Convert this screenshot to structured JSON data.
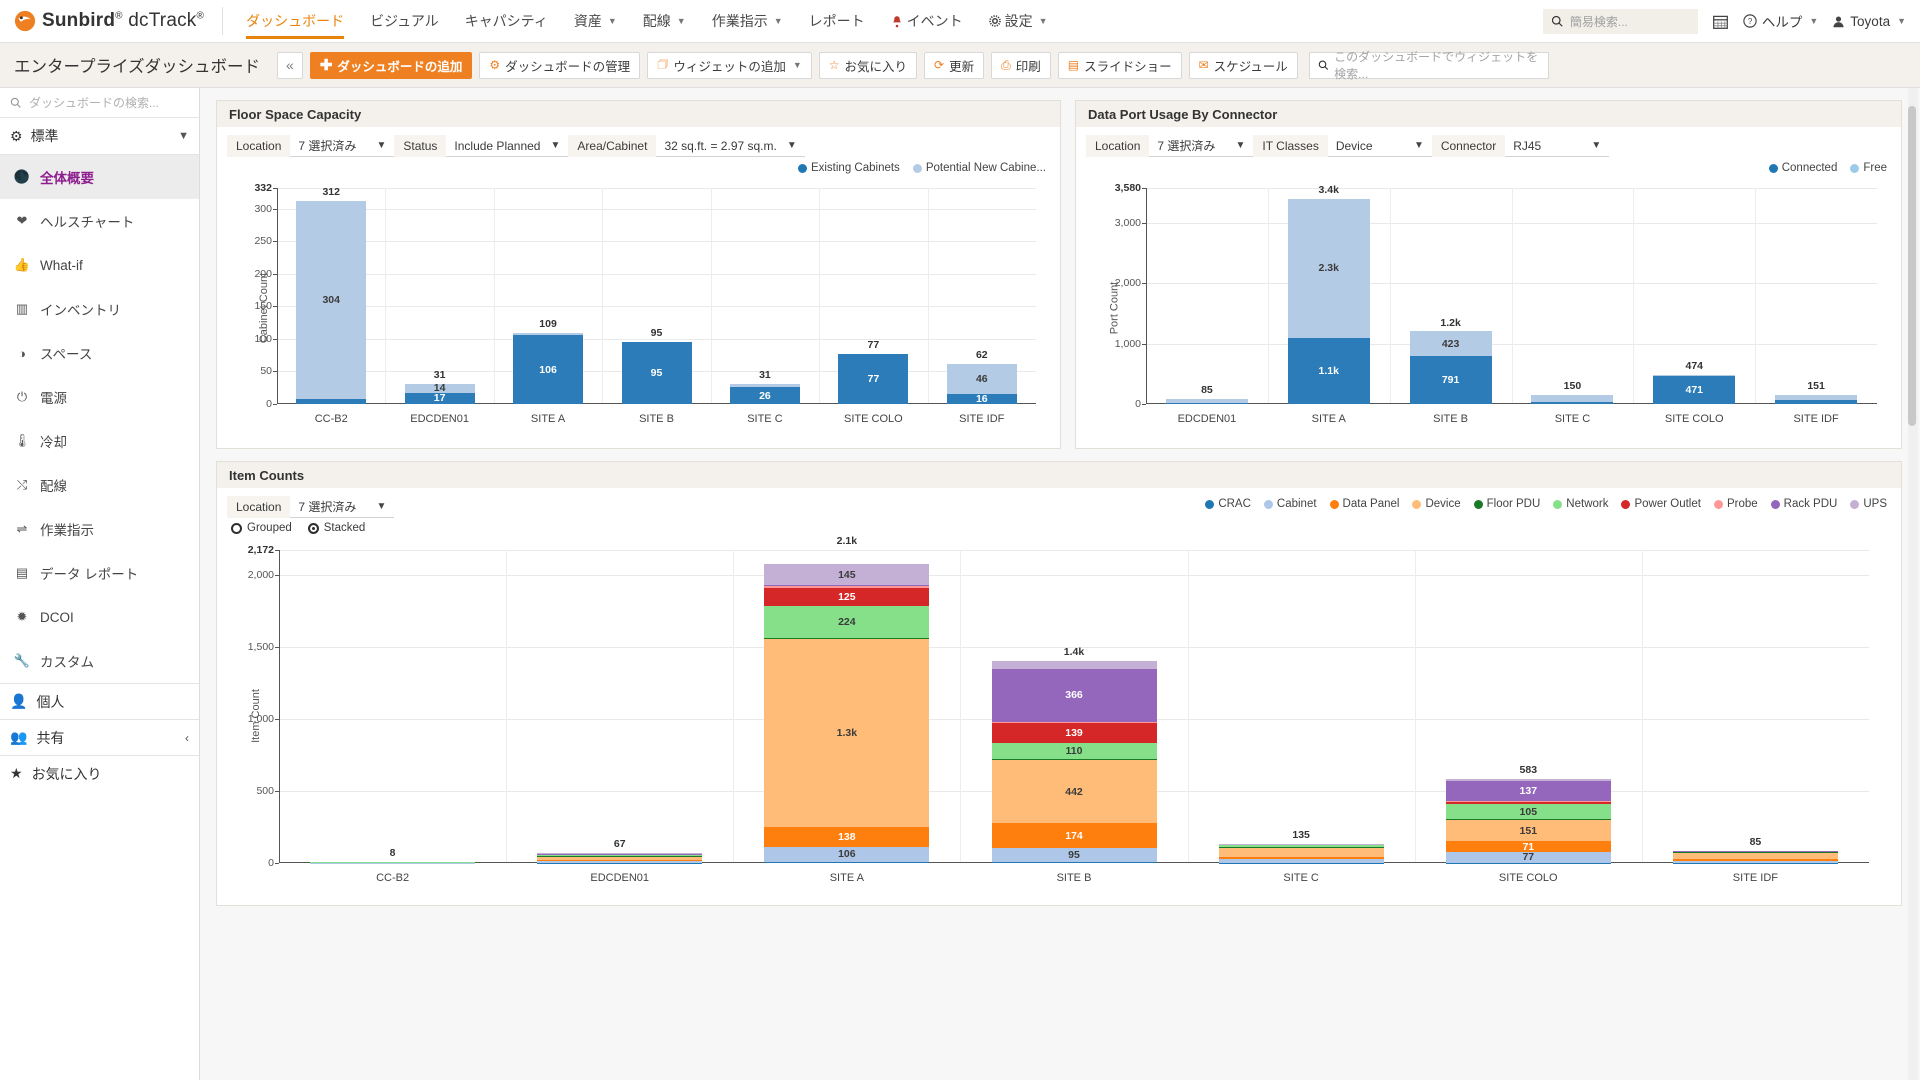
{
  "app": {
    "brand_name": "Sunbird",
    "brand_product": "dcTrack",
    "brand_sup": "®"
  },
  "topnav": {
    "items": [
      {
        "label": "ダッシュボード",
        "active": true,
        "caret": false,
        "icon": null
      },
      {
        "label": "ビジュアル",
        "active": false,
        "caret": false,
        "icon": null
      },
      {
        "label": "キャパシティ",
        "active": false,
        "caret": false,
        "icon": null
      },
      {
        "label": "資産",
        "active": false,
        "caret": true,
        "icon": null
      },
      {
        "label": "配線",
        "active": false,
        "caret": true,
        "icon": null
      },
      {
        "label": "作業指示",
        "active": false,
        "caret": true,
        "icon": null
      },
      {
        "label": "レポート",
        "active": false,
        "caret": false,
        "icon": null
      },
      {
        "label": "イベント",
        "active": false,
        "caret": false,
        "icon": "bell-icon"
      },
      {
        "label": "設定",
        "active": false,
        "caret": true,
        "icon": "gear-icon"
      }
    ],
    "quick_search_placeholder": "簡易検索...",
    "calendar_icon": "calendar-icon",
    "help_label": "ヘルプ",
    "user_label": "Toyota"
  },
  "toolbar": {
    "dashboard_title": "エンタープライズダッシュボード",
    "collapse_label": "«",
    "buttons": [
      {
        "label": "ダッシュボードの追加",
        "icon": "plus-icon",
        "primary": true,
        "caret": false
      },
      {
        "label": "ダッシュボードの管理",
        "icon": "gear-icon",
        "primary": false,
        "caret": false
      },
      {
        "label": "ウィジェットの追加",
        "icon": "widget-add-icon",
        "primary": false,
        "caret": true
      },
      {
        "label": "お気に入り",
        "icon": "star-icon",
        "primary": false,
        "caret": false
      },
      {
        "label": "更新",
        "icon": "refresh-icon",
        "primary": false,
        "caret": false
      },
      {
        "label": "印刷",
        "icon": "print-icon",
        "primary": false,
        "caret": false
      },
      {
        "label": "スライドショー",
        "icon": "slideshow-icon",
        "primary": false,
        "caret": false
      },
      {
        "label": "スケジュール",
        "icon": "envelope-icon",
        "primary": false,
        "caret": false
      }
    ],
    "widget_search_placeholder": "このダッシュボードでウィジェットを検索..."
  },
  "sidebar": {
    "search_placeholder": "ダッシュボードの検索...",
    "group_label": "標準",
    "group_icon": "cogs-icon",
    "items": [
      {
        "label": "全体概要",
        "icon": "globe-icon",
        "active": true
      },
      {
        "label": "ヘルスチャート",
        "icon": "heartbeat-icon",
        "active": false
      },
      {
        "label": "What-if",
        "icon": "thumbs-up-icon",
        "active": false
      },
      {
        "label": "インベントリ",
        "icon": "barcode-icon",
        "active": false
      },
      {
        "label": "スペース",
        "icon": "gauge-icon",
        "active": false
      },
      {
        "label": "電源",
        "icon": "power-icon",
        "active": false
      },
      {
        "label": "冷却",
        "icon": "thermometer-icon",
        "active": false
      },
      {
        "label": "配線",
        "icon": "shuffle-icon",
        "active": false
      },
      {
        "label": "作業指示",
        "icon": "exchange-icon",
        "active": false
      },
      {
        "label": "データ レポート",
        "icon": "report-icon",
        "active": false
      },
      {
        "label": "DCOI",
        "icon": "sun-icon",
        "active": false
      },
      {
        "label": "カスタム",
        "icon": "wrench-icon",
        "active": false
      }
    ],
    "sections": [
      {
        "label": "個人",
        "icon": "user-icon",
        "caret": ""
      },
      {
        "label": "共有",
        "icon": "users-icon",
        "caret": "‹"
      },
      {
        "label": "お気に入り",
        "icon": "star-icon",
        "caret": ""
      }
    ]
  },
  "panels": {
    "floor_space": {
      "title": "Floor Space Capacity",
      "filters": [
        {
          "label": "Location",
          "value": "7 選択済み",
          "type": "select"
        },
        {
          "label": "Status",
          "value": "Include Planned",
          "type": "select"
        },
        {
          "label": "Area/Cabinet",
          "value": "32 sq.ft. = 2.97 sq.m.",
          "type": "select"
        }
      ]
    },
    "data_port": {
      "title": "Data Port Usage By Connector",
      "filters": [
        {
          "label": "Location",
          "value": "7 選択済み",
          "type": "select"
        },
        {
          "label": "IT Classes",
          "value": "Device",
          "type": "select"
        },
        {
          "label": "Connector",
          "value": "RJ45",
          "type": "select"
        }
      ]
    },
    "item_counts": {
      "title": "Item Counts",
      "filters": [
        {
          "label": "Location",
          "value": "7 選択済み",
          "type": "select"
        }
      ],
      "mode_options": [
        {
          "label": "Grouped",
          "selected": false
        },
        {
          "label": "Stacked",
          "selected": true
        }
      ]
    }
  },
  "chart_data": [
    {
      "type": "bar",
      "id": "floor-space-capacity",
      "title": "Floor Space Capacity",
      "stacked": true,
      "xlabel": "",
      "ylabel": "Cabinet Count",
      "ylim": [
        0,
        332
      ],
      "yticks": [
        0,
        50,
        100,
        150,
        200,
        250,
        300,
        332
      ],
      "ytick_labels": [
        "0",
        "50",
        "100",
        "150",
        "200",
        "250",
        "300",
        "332"
      ],
      "grid": true,
      "legend_position": "top-right",
      "categories": [
        "CC-B2",
        "EDCDEN01",
        "SITE A",
        "SITE B",
        "SITE C",
        "SITE COLO",
        "SITE IDF"
      ],
      "series": [
        {
          "name": "Existing Cabinets",
          "color": "#2b7cb8",
          "values": [
            8,
            17,
            106,
            95,
            26,
            77,
            16
          ],
          "labels": [
            "",
            "17",
            "106",
            "95",
            "26",
            "77",
            "16"
          ]
        },
        {
          "name": "Potential New Cabine...",
          "color": "#b4cbe6",
          "values": [
            304,
            14,
            3,
            0,
            5,
            0,
            46
          ],
          "labels": [
            "304",
            "14",
            "",
            "",
            "",
            "",
            "46"
          ]
        }
      ],
      "totals": [
        312,
        31,
        109,
        95,
        31,
        77,
        62
      ],
      "total_labels": [
        "312",
        "31",
        "109",
        "95",
        "31",
        "77",
        "62"
      ]
    },
    {
      "type": "bar",
      "id": "data-port-usage-by-connector",
      "title": "Data Port Usage By Connector",
      "stacked": true,
      "xlabel": "",
      "ylabel": "Port Count",
      "ylim": [
        0,
        3580
      ],
      "yticks": [
        0,
        1000,
        2000,
        3000,
        3580
      ],
      "ytick_labels": [
        "0",
        "1,000",
        "2,000",
        "3,000",
        "3,580"
      ],
      "grid": true,
      "legend_position": "top-right",
      "categories": [
        "EDCDEN01",
        "SITE A",
        "SITE B",
        "SITE C",
        "SITE COLO",
        "SITE IDF"
      ],
      "series": [
        {
          "name": "Connected",
          "color": "#2b7cb8",
          "values": [
            20,
            1100,
            791,
            30,
            471,
            60
          ],
          "labels": [
            "",
            "1.1k",
            "791",
            "",
            "471",
            ""
          ]
        },
        {
          "name": "Free",
          "color": "#b4cbe6",
          "values": [
            65,
            2300,
            423,
            120,
            3,
            91
          ],
          "labels": [
            "",
            "2.3k",
            "423",
            "",
            "",
            ""
          ]
        }
      ],
      "totals": [
        85,
        3400,
        1200,
        150,
        474,
        151
      ],
      "total_labels": [
        "85",
        "3.4k",
        "1.2k",
        "150",
        "474",
        "151"
      ]
    },
    {
      "type": "bar",
      "id": "item-counts",
      "title": "Item Counts",
      "stacked": true,
      "xlabel": "",
      "ylabel": "Item Count",
      "ylim": [
        0,
        2172
      ],
      "yticks": [
        0,
        500,
        1000,
        1500,
        2000,
        2172
      ],
      "ytick_labels": [
        "0",
        "500",
        "1,000",
        "1,500",
        "2,000",
        "2,172"
      ],
      "grid": true,
      "legend_position": "top-right",
      "categories": [
        "CC-B2",
        "EDCDEN01",
        "SITE A",
        "SITE B",
        "SITE C",
        "SITE COLO",
        "SITE IDF"
      ],
      "series": [
        {
          "name": "CRAC",
          "color": "#1f77b4",
          "values": [
            0,
            2,
            8,
            6,
            3,
            2,
            1
          ],
          "labels": [
            "",
            "",
            "",
            "",
            "",
            "",
            ""
          ]
        },
        {
          "name": "Cabinet",
          "color": "#aec7e8",
          "values": [
            3,
            10,
            106,
            95,
            26,
            77,
            16
          ],
          "labels": [
            "",
            "",
            "106",
            "95",
            "",
            "77",
            ""
          ]
        },
        {
          "name": "Data Panel",
          "color": "#ff7f0e",
          "values": [
            1,
            8,
            138,
            174,
            12,
            71,
            8
          ],
          "labels": [
            "",
            "",
            "138",
            "174",
            "",
            "71",
            ""
          ]
        },
        {
          "name": "Device",
          "color": "#ffbb78",
          "values": [
            3,
            30,
            1300,
            442,
            70,
            151,
            52
          ],
          "labels": [
            "",
            "",
            "1.3k",
            "442",
            "",
            "151",
            ""
          ]
        },
        {
          "name": "Floor PDU",
          "color": "#1a7a28",
          "values": [
            0,
            2,
            10,
            8,
            3,
            2,
            1
          ],
          "labels": [
            "",
            "",
            "",
            "",
            "",
            "",
            ""
          ]
        },
        {
          "name": "Network",
          "color": "#86e08a",
          "values": [
            1,
            6,
            224,
            110,
            10,
            105,
            4
          ],
          "labels": [
            "",
            "",
            "224",
            "110",
            "",
            "105",
            ""
          ]
        },
        {
          "name": "Power Outlet",
          "color": "#d62728",
          "values": [
            0,
            5,
            125,
            139,
            6,
            19,
            2
          ],
          "labels": [
            "",
            "",
            "125",
            "139",
            "",
            "",
            ""
          ]
        },
        {
          "name": "Probe",
          "color": "#ff9896",
          "values": [
            0,
            1,
            12,
            8,
            2,
            6,
            0
          ],
          "labels": [
            "",
            "",
            "",
            "",
            "",
            "",
            ""
          ]
        },
        {
          "name": "Rack PDU",
          "color": "#9467bd",
          "values": [
            0,
            2,
            4,
            366,
            2,
            137,
            1
          ],
          "labels": [
            "",
            "",
            "",
            "366",
            "",
            "137",
            ""
          ]
        },
        {
          "name": "UPS",
          "color": "#c5b0d5",
          "values": [
            0,
            1,
            145,
            52,
            1,
            13,
            0
          ],
          "labels": [
            "",
            "",
            "145",
            "",
            "",
            "",
            ""
          ]
        }
      ],
      "totals": [
        8,
        67,
        2172,
        1400,
        135,
        583,
        85
      ],
      "total_labels": [
        "8",
        "67",
        "2.1k",
        "1.4k",
        "135",
        "583",
        "85"
      ]
    }
  ],
  "legends": {
    "floor_space": [
      {
        "label": "Existing Cabinets",
        "color": "#1f77b4"
      },
      {
        "label": "Potential New Cabine...",
        "color": "#b4cbe6"
      }
    ],
    "data_port": [
      {
        "label": "Connected",
        "color": "#1f77b4"
      },
      {
        "label": "Free",
        "color": "#9ecae9"
      }
    ],
    "item_counts": [
      {
        "label": "CRAC",
        "color": "#1f77b4"
      },
      {
        "label": "Cabinet",
        "color": "#aec7e8"
      },
      {
        "label": "Data Panel",
        "color": "#ff7f0e"
      },
      {
        "label": "Device",
        "color": "#ffbb78"
      },
      {
        "label": "Floor PDU",
        "color": "#1a7a28"
      },
      {
        "label": "Network",
        "color": "#86e08a"
      },
      {
        "label": "Power Outlet",
        "color": "#d62728"
      },
      {
        "label": "Probe",
        "color": "#ff9896"
      },
      {
        "label": "Rack PDU",
        "color": "#9467bd"
      },
      {
        "label": "UPS",
        "color": "#c5b0d5"
      }
    ]
  }
}
